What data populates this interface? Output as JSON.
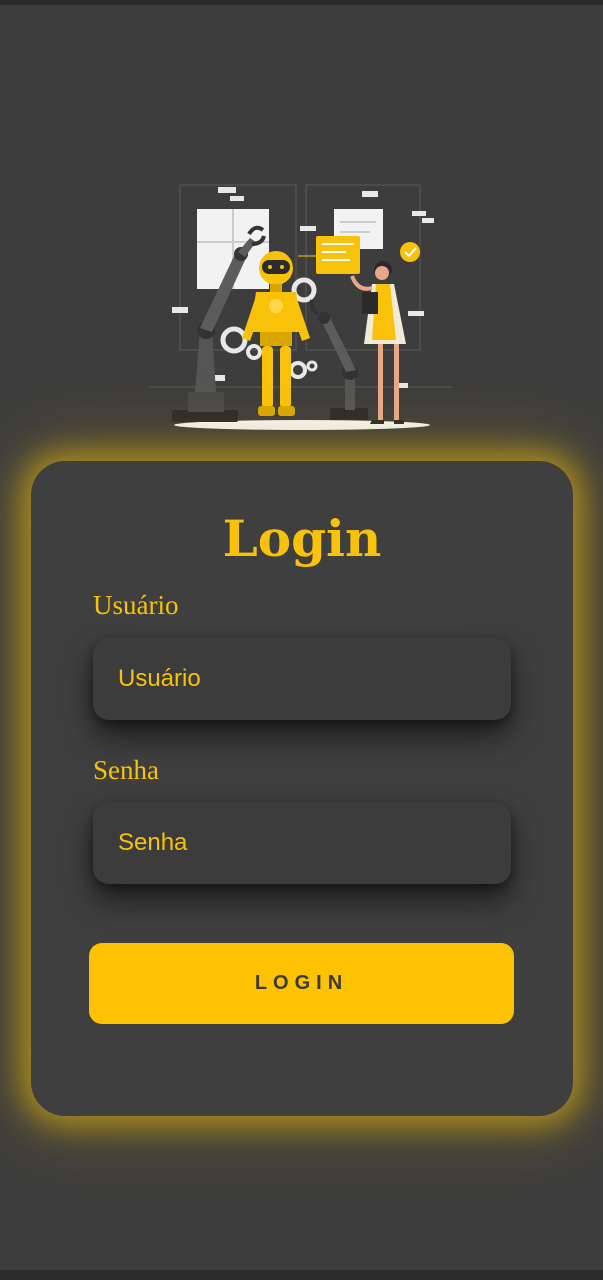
{
  "login": {
    "title": "Login",
    "username": {
      "label": "Usuário",
      "placeholder": "Usuário",
      "value": ""
    },
    "password": {
      "label": "Senha",
      "placeholder": "Senha",
      "value": ""
    },
    "submit_label": "LOGIN"
  },
  "colors": {
    "background": "#3d3d3d",
    "card": "#3f3f3f",
    "accent": "#f9c20a",
    "button": "#fec204",
    "button_text": "#3a3a3a"
  },
  "illustration": {
    "icon": "robot-engineer-illustration"
  }
}
